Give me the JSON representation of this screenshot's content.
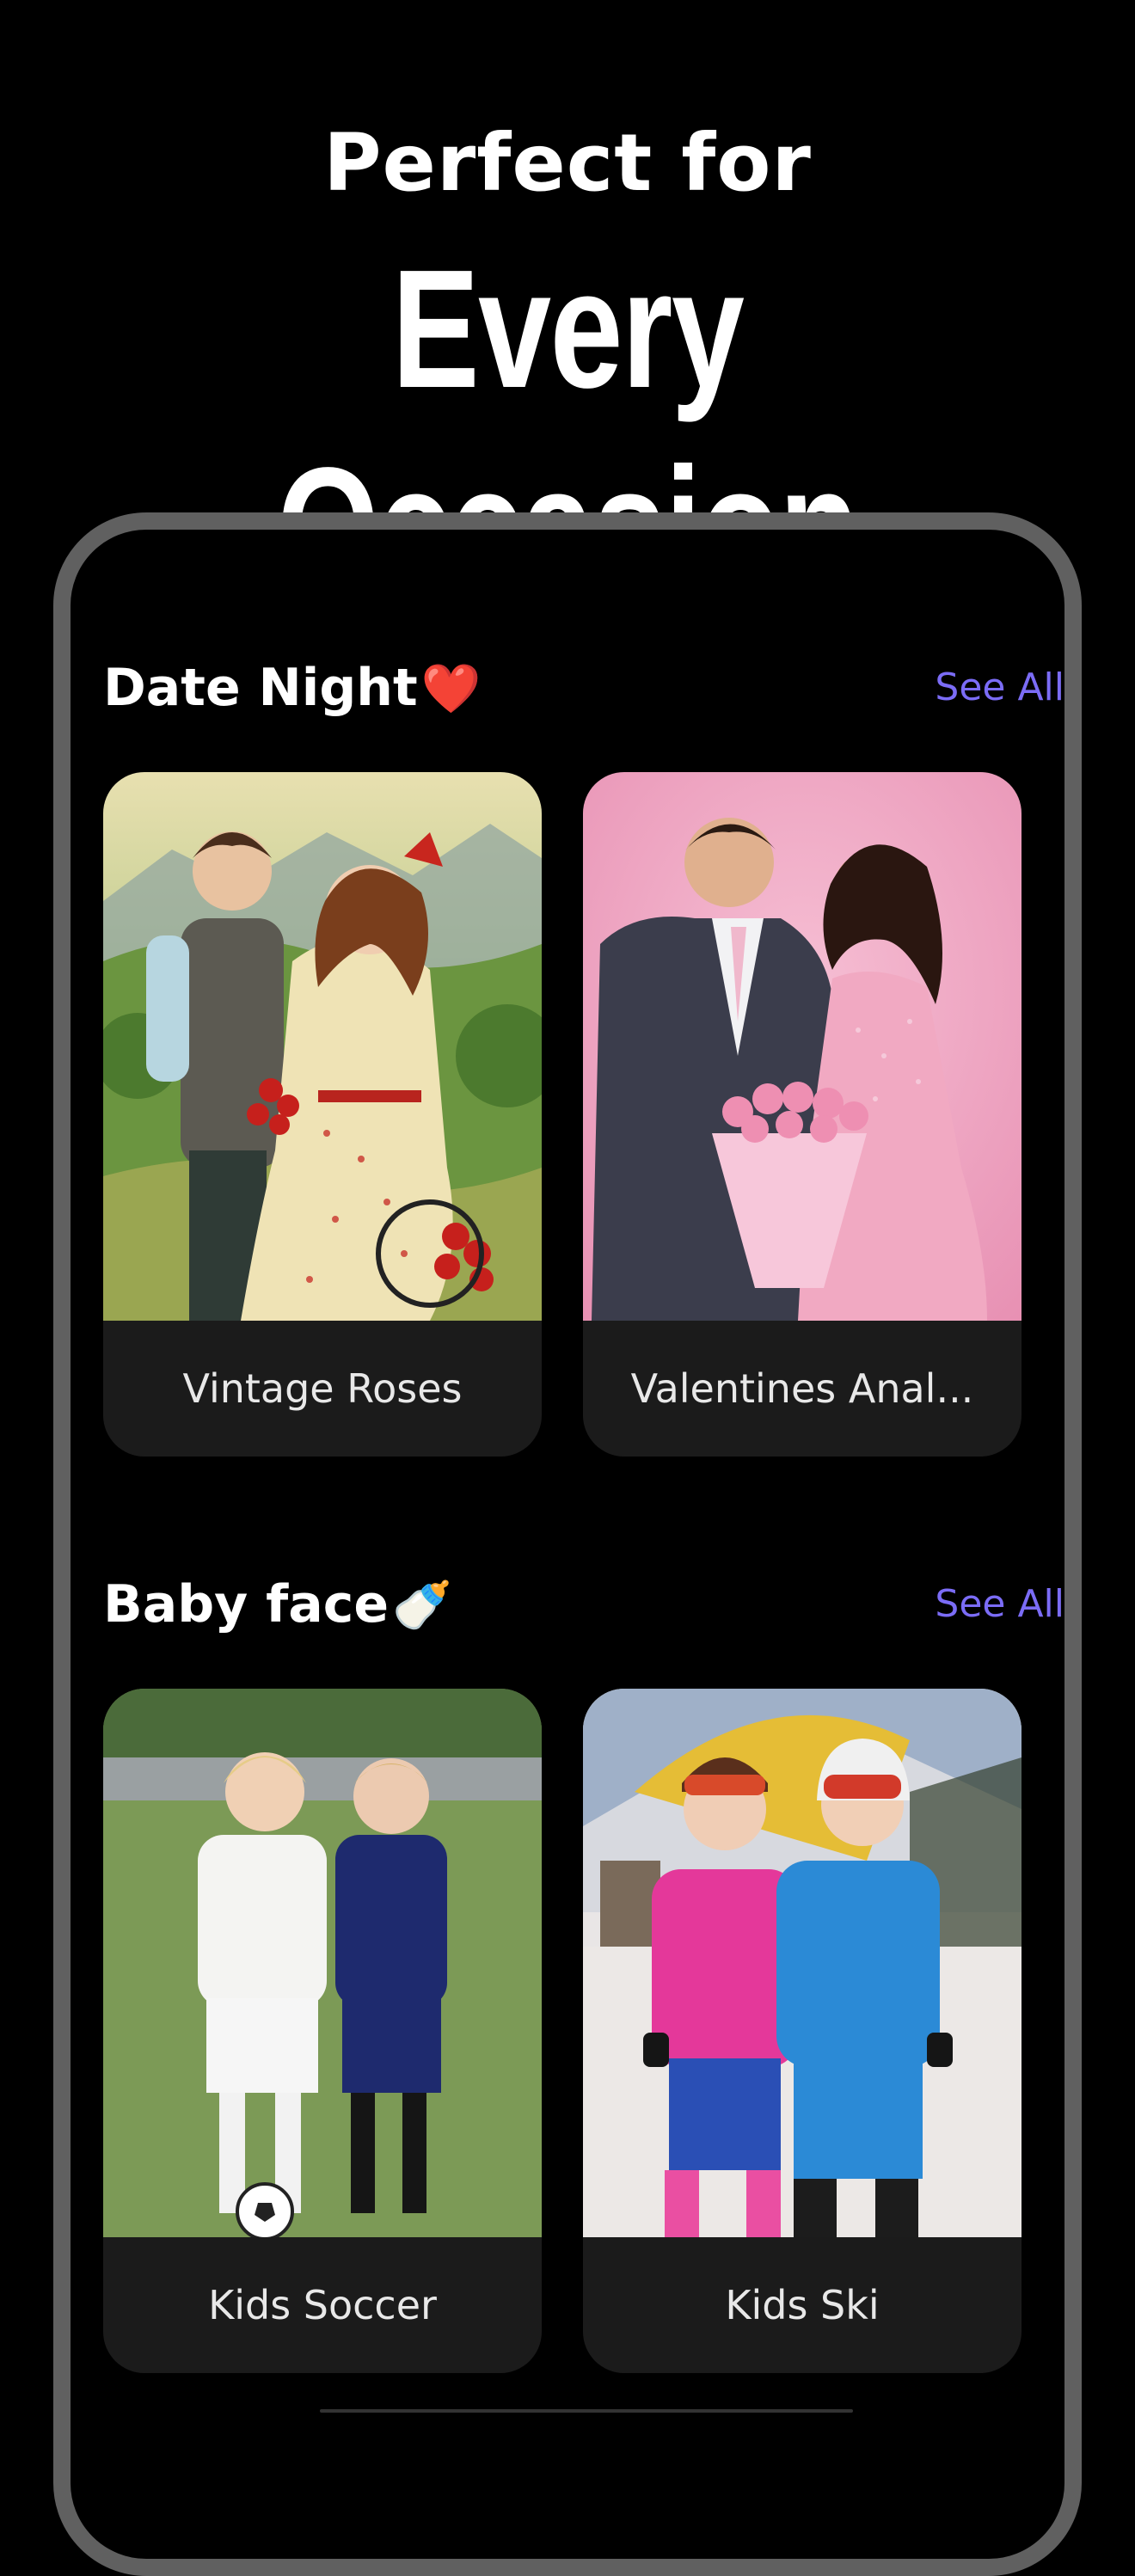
{
  "headline": {
    "line1": "Perfect for",
    "line2": "Every Occasion"
  },
  "sections": [
    {
      "title": "Date Night",
      "emoji": "❤️",
      "see_all": "See All",
      "cards": [
        {
          "label": "Vintage Roses"
        },
        {
          "label": "Valentines Anal..."
        }
      ]
    },
    {
      "title": "Baby face",
      "emoji": "🍼",
      "see_all": "See All",
      "cards": [
        {
          "label": "Kids Soccer"
        },
        {
          "label": "Kids Ski"
        }
      ]
    }
  ],
  "colors": {
    "background": "#000000",
    "accent": "#7b6cf6",
    "card": "#1b1b1b",
    "phone_frame": "#606060"
  }
}
